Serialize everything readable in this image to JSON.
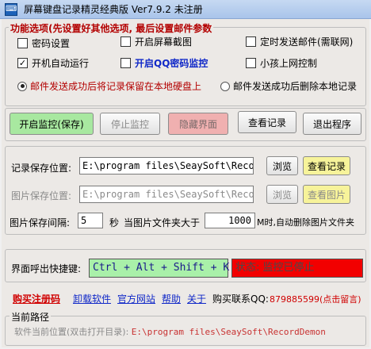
{
  "window": {
    "title": "屏幕键盘记录精灵经典版  Ver7.9.2  未注册"
  },
  "options": {
    "title": "功能选项(先设置好其他选项, 最后设置邮件参数",
    "password": {
      "label": "密码设置",
      "checked": false
    },
    "screenshot": {
      "label": "开启屏幕截图",
      "checked": false
    },
    "timed_mail": {
      "label": "定时发送邮件(需联网)",
      "checked": false
    },
    "autorun": {
      "label": "开机自动运行",
      "checked": true
    },
    "qq_monitor": {
      "label": "开启QQ密码监控",
      "checked": false
    },
    "kids_control": {
      "label": "小孩上网控制",
      "checked": false
    },
    "radio_keep": {
      "label": "邮件发送成功后将记录保留在本地硬盘上",
      "selected": true
    },
    "radio_delete": {
      "label": "邮件发送成功后删除本地记录",
      "selected": false
    }
  },
  "actions": {
    "start": "开启监控(保存)",
    "stop": "停止监控",
    "hide": "隐藏界面",
    "view": "查看记录",
    "exit": "退出程序"
  },
  "storage": {
    "record_label": "记录保存位置:",
    "record_path": "E:\\program files\\SeaySoft\\Record",
    "browse": "浏览",
    "view_records": "查看记录",
    "image_label": "图片保存位置:",
    "image_path": "E:\\program files\\SeaySoft\\Recor",
    "view_images": "查看图片",
    "interval_label": "图片保存间隔:",
    "interval_value": "5",
    "seconds": "秒",
    "folder_label": "当图片文件夹大于",
    "size_value": "1000",
    "size_suffix": "M时,自动删除图片文件夹"
  },
  "hotkey": {
    "label": "界面呼出快捷键:",
    "value": "Ctrl + Alt + Shift + K",
    "status": "状态: 监控已停止"
  },
  "links": {
    "buy": "购买注册码",
    "uninstall": "卸载软件",
    "website": "官方网站",
    "help": "帮助",
    "about": "关于",
    "contact_label": "购买联系QQ:",
    "contact_value": "879885599(点击留言)"
  },
  "path": {
    "title": "当前路径",
    "prefix": "软件当前位置(双击打开目录):",
    "value": "E:\\program files\\SeaySoft\\RecordDemon"
  },
  "colors": {
    "status_bg": "#f20000",
    "hotkey_bg": "#a9f0a9",
    "start_bg": "#a8e8a0",
    "hide_bg": "#f0b0b0",
    "view_bg": "#f7f39a"
  }
}
